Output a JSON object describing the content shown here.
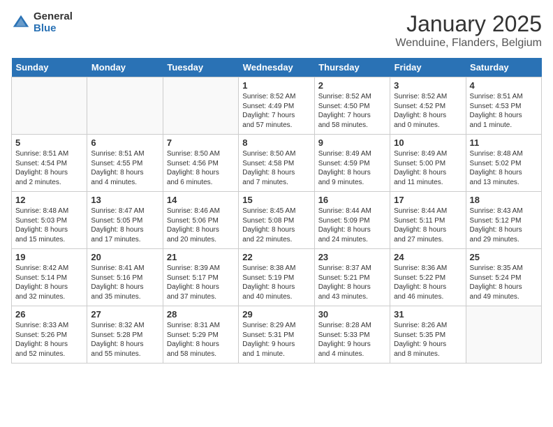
{
  "header": {
    "logo_general": "General",
    "logo_blue": "Blue",
    "title": "January 2025",
    "subtitle": "Wenduine, Flanders, Belgium"
  },
  "days_of_week": [
    "Sunday",
    "Monday",
    "Tuesday",
    "Wednesday",
    "Thursday",
    "Friday",
    "Saturday"
  ],
  "weeks": [
    [
      {
        "date": "",
        "text": ""
      },
      {
        "date": "",
        "text": ""
      },
      {
        "date": "",
        "text": ""
      },
      {
        "date": "1",
        "text": "Sunrise: 8:52 AM\nSunset: 4:49 PM\nDaylight: 7 hours\nand 57 minutes."
      },
      {
        "date": "2",
        "text": "Sunrise: 8:52 AM\nSunset: 4:50 PM\nDaylight: 7 hours\nand 58 minutes."
      },
      {
        "date": "3",
        "text": "Sunrise: 8:52 AM\nSunset: 4:52 PM\nDaylight: 8 hours\nand 0 minutes."
      },
      {
        "date": "4",
        "text": "Sunrise: 8:51 AM\nSunset: 4:53 PM\nDaylight: 8 hours\nand 1 minute."
      }
    ],
    [
      {
        "date": "5",
        "text": "Sunrise: 8:51 AM\nSunset: 4:54 PM\nDaylight: 8 hours\nand 2 minutes."
      },
      {
        "date": "6",
        "text": "Sunrise: 8:51 AM\nSunset: 4:55 PM\nDaylight: 8 hours\nand 4 minutes."
      },
      {
        "date": "7",
        "text": "Sunrise: 8:50 AM\nSunset: 4:56 PM\nDaylight: 8 hours\nand 6 minutes."
      },
      {
        "date": "8",
        "text": "Sunrise: 8:50 AM\nSunset: 4:58 PM\nDaylight: 8 hours\nand 7 minutes."
      },
      {
        "date": "9",
        "text": "Sunrise: 8:49 AM\nSunset: 4:59 PM\nDaylight: 8 hours\nand 9 minutes."
      },
      {
        "date": "10",
        "text": "Sunrise: 8:49 AM\nSunset: 5:00 PM\nDaylight: 8 hours\nand 11 minutes."
      },
      {
        "date": "11",
        "text": "Sunrise: 8:48 AM\nSunset: 5:02 PM\nDaylight: 8 hours\nand 13 minutes."
      }
    ],
    [
      {
        "date": "12",
        "text": "Sunrise: 8:48 AM\nSunset: 5:03 PM\nDaylight: 8 hours\nand 15 minutes."
      },
      {
        "date": "13",
        "text": "Sunrise: 8:47 AM\nSunset: 5:05 PM\nDaylight: 8 hours\nand 17 minutes."
      },
      {
        "date": "14",
        "text": "Sunrise: 8:46 AM\nSunset: 5:06 PM\nDaylight: 8 hours\nand 20 minutes."
      },
      {
        "date": "15",
        "text": "Sunrise: 8:45 AM\nSunset: 5:08 PM\nDaylight: 8 hours\nand 22 minutes."
      },
      {
        "date": "16",
        "text": "Sunrise: 8:44 AM\nSunset: 5:09 PM\nDaylight: 8 hours\nand 24 minutes."
      },
      {
        "date": "17",
        "text": "Sunrise: 8:44 AM\nSunset: 5:11 PM\nDaylight: 8 hours\nand 27 minutes."
      },
      {
        "date": "18",
        "text": "Sunrise: 8:43 AM\nSunset: 5:12 PM\nDaylight: 8 hours\nand 29 minutes."
      }
    ],
    [
      {
        "date": "19",
        "text": "Sunrise: 8:42 AM\nSunset: 5:14 PM\nDaylight: 8 hours\nand 32 minutes."
      },
      {
        "date": "20",
        "text": "Sunrise: 8:41 AM\nSunset: 5:16 PM\nDaylight: 8 hours\nand 35 minutes."
      },
      {
        "date": "21",
        "text": "Sunrise: 8:39 AM\nSunset: 5:17 PM\nDaylight: 8 hours\nand 37 minutes."
      },
      {
        "date": "22",
        "text": "Sunrise: 8:38 AM\nSunset: 5:19 PM\nDaylight: 8 hours\nand 40 minutes."
      },
      {
        "date": "23",
        "text": "Sunrise: 8:37 AM\nSunset: 5:21 PM\nDaylight: 8 hours\nand 43 minutes."
      },
      {
        "date": "24",
        "text": "Sunrise: 8:36 AM\nSunset: 5:22 PM\nDaylight: 8 hours\nand 46 minutes."
      },
      {
        "date": "25",
        "text": "Sunrise: 8:35 AM\nSunset: 5:24 PM\nDaylight: 8 hours\nand 49 minutes."
      }
    ],
    [
      {
        "date": "26",
        "text": "Sunrise: 8:33 AM\nSunset: 5:26 PM\nDaylight: 8 hours\nand 52 minutes."
      },
      {
        "date": "27",
        "text": "Sunrise: 8:32 AM\nSunset: 5:28 PM\nDaylight: 8 hours\nand 55 minutes."
      },
      {
        "date": "28",
        "text": "Sunrise: 8:31 AM\nSunset: 5:29 PM\nDaylight: 8 hours\nand 58 minutes."
      },
      {
        "date": "29",
        "text": "Sunrise: 8:29 AM\nSunset: 5:31 PM\nDaylight: 9 hours\nand 1 minute."
      },
      {
        "date": "30",
        "text": "Sunrise: 8:28 AM\nSunset: 5:33 PM\nDaylight: 9 hours\nand 4 minutes."
      },
      {
        "date": "31",
        "text": "Sunrise: 8:26 AM\nSunset: 5:35 PM\nDaylight: 9 hours\nand 8 minutes."
      },
      {
        "date": "",
        "text": ""
      }
    ]
  ]
}
